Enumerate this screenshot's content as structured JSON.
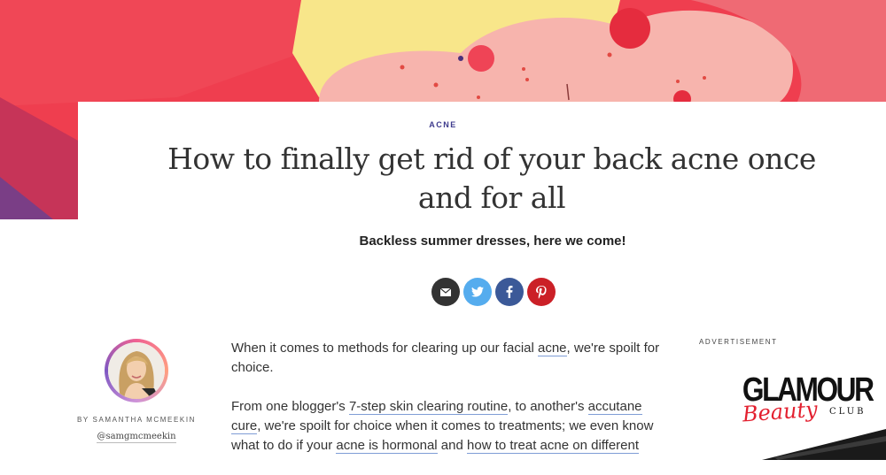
{
  "hero": {
    "image": "skin-illustration-artwork"
  },
  "article": {
    "category": "ACNE",
    "title": "How to finally get rid of your back acne once and for all",
    "subtitle": "Backless summer dresses, here we come!"
  },
  "share": [
    {
      "name": "email",
      "icon": "envelope-icon",
      "color": "#333333"
    },
    {
      "name": "twitter",
      "icon": "twitter-icon",
      "color": "#55acee"
    },
    {
      "name": "facebook",
      "icon": "facebook-icon",
      "color": "#3b5998"
    },
    {
      "name": "pinterest",
      "icon": "pinterest-icon",
      "color": "#cb2027"
    }
  ],
  "author": {
    "byline": "BY SAMANTHA MCMEEKIN",
    "handle": "@samgmcmeekin"
  },
  "body": {
    "p1": {
      "t1": "When it comes to methods for clearing up our facial ",
      "l1": "acne",
      "t2": ", we're spoilt for choice."
    },
    "p2": {
      "t1": "From one blogger's ",
      "l1": "7-step skin clearing routine",
      "t2": ", to another's ",
      "l2": "accutane cure",
      "t3": ", we're spoilt for choice when it comes to treatments; we even know what to do if your ",
      "l3": "acne is hormonal",
      "t4": " and ",
      "l4": "how to treat acne on different"
    }
  },
  "ad": {
    "label": "ADVERTISEMENT",
    "logo_line1": "GLAMOUR",
    "logo_script": "Beauty",
    "logo_club": "CLUB"
  },
  "colors": {
    "category": "#3d3a8c",
    "link_underline": "#7f9dd6",
    "hero_red": "#ef3e4f",
    "hero_pink": "#f7b4ad",
    "hero_yellow": "#f8e68a"
  }
}
